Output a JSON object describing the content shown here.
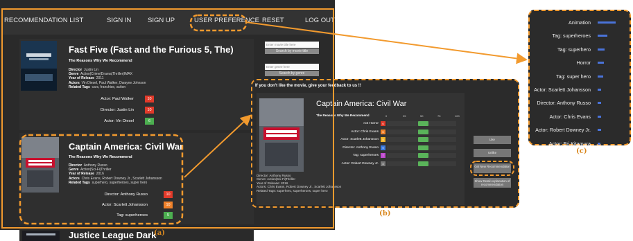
{
  "nav": {
    "items": [
      "RECOMMENDATION LIST",
      "SIGN IN",
      "SIGN UP",
      "USER PREFERENCE",
      "RESET",
      "LOG OUT"
    ]
  },
  "movies": [
    {
      "title": "Fast Five (Fast and the Furious 5, The)",
      "reasons_heading": "The Reasons Why We Recommend",
      "director_key": "Director",
      "director": "Justin Lin",
      "genre_key": "Genre",
      "genre": "Action|Crime|Drama|Thriller|IMAX",
      "year_key": "Year of Release",
      "year": "2011",
      "actors_key": "Actors",
      "actors": "Vin Diesel, Paul Walker, Dwayne Johnson",
      "tags_key": "Related Tags",
      "tags": "cars, franchise, action",
      "scores": [
        {
          "label": "Actor: Paul Walker",
          "value": "10",
          "color": "#e23a2a"
        },
        {
          "label": "Director: Justin Lin",
          "value": "10",
          "color": "#e23a2a"
        },
        {
          "label": "Actor: Vin Diesel",
          "value": "6",
          "color": "#4caf50"
        }
      ]
    },
    {
      "title": "Captain America: Civil War",
      "reasons_heading": "The Reasons Why We Recommend",
      "director_key": "Director",
      "director": "Anthony Russo",
      "genre_key": "Genre",
      "genre": "Action|Sci-Fi|Thriller",
      "year_key": "Year of Release",
      "year": "2016",
      "actors_key": "Actors",
      "actors": "Chris Evans, Robert Downey Jr., Scarlett Johansson",
      "tags_key": "Related Tags",
      "tags": "superhero, superheroes, super hero",
      "scores": [
        {
          "label": "Director: Anthony Russo",
          "value": "10",
          "color": "#e23a2a"
        },
        {
          "label": "Actor: Scarlett Johansson",
          "value": "10",
          "color": "#f0812a"
        },
        {
          "label": "Tag: superheroes",
          "value": "5",
          "color": "#4caf50"
        }
      ]
    },
    {
      "title": "Justice League Dark"
    }
  ],
  "sidebar": {
    "title_placeholder": "Enter movie title here",
    "title_button": "Search by movie title",
    "genre_placeholder": "Enter genre here",
    "genre_button": "Search by genre"
  },
  "feedback": {
    "heading": "If you don't like the movie, give your feedback to us !!",
    "movie_title": "Captain America: Civil War",
    "reasons_heading": "The Reasons Why We Recommend",
    "ticks": [
      "0",
      "25",
      "50",
      "75",
      "100"
    ],
    "rows": [
      {
        "label": "not Horror",
        "value": "6",
        "color": "#e23a2a",
        "level": 0.45
      },
      {
        "label": "Actor: Chris Evans",
        "value": "5",
        "color": "#f0812a",
        "level": 0.45
      },
      {
        "label": "Actor: Scarlett Johansson",
        "value": "5",
        "color": "#f0b429",
        "level": 0.45
      },
      {
        "label": "Director: Anthony Russo",
        "value": "9",
        "color": "#3b7be0",
        "level": 0.45
      },
      {
        "label": "Tag: superheroes",
        "value": "7",
        "color": "#c04ad0",
        "level": 0.45
      },
      {
        "label": "Actor: Robert Downey Jr.",
        "value": "4",
        "color": "#777777",
        "level": 0.45
      }
    ],
    "meta_director": "Director: Anthony Russo",
    "meta_genre": "Genre: Action|Sci-Fi|Thriller",
    "meta_year": "Year of Release: 2016",
    "meta_actors": "Actors: Chris Evans, Robert Downey Jr., Scarlett Johansson",
    "meta_tags": "Related Tags: superhero, superheroes, super hero",
    "buttons": [
      "Like",
      "Unlike",
      "Get New Recommendation",
      "Show Detail explanation of recommendation"
    ]
  },
  "preferences": {
    "items": [
      {
        "label": "Animation",
        "weight": 1.0
      },
      {
        "label": "Tag: superheroes",
        "weight": 0.55
      },
      {
        "label": "Tag: superhero",
        "weight": 0.4
      },
      {
        "label": "Horror",
        "weight": 0.35
      },
      {
        "label": "Tag: super hero",
        "weight": 0.3
      },
      {
        "label": "Actor: Scarlett Johansson",
        "weight": 0.2
      },
      {
        "label": "Director: Anthony Russo",
        "weight": 0.2
      },
      {
        "label": "Actor: Chris Evans",
        "weight": 0.2
      },
      {
        "label": "Actor: Robert Downey Jr.",
        "weight": 0.18
      },
      {
        "label": "Actor: Eri Kitamura",
        "weight": 0.15
      }
    ]
  },
  "annotations": {
    "a": "(a)",
    "b": "(b)",
    "c": "(c)"
  }
}
